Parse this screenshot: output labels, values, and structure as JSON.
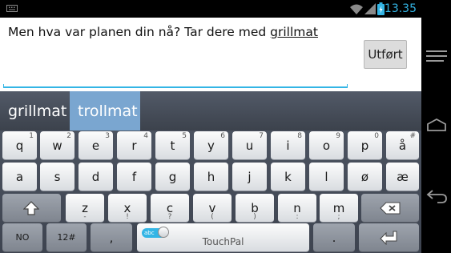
{
  "status_bar": {
    "time": "13.35"
  },
  "compose": {
    "text_before": "Men hva var planen din nå? Tar dere med ",
    "text_underlined": "grillmat",
    "done_label": "Utført"
  },
  "suggestions": [
    {
      "label": "grillmat",
      "selected": false
    },
    {
      "label": "trollmat",
      "selected": true
    }
  ],
  "keyboard": {
    "row1": [
      {
        "main": "q",
        "hint": "1"
      },
      {
        "main": "w",
        "hint": "2"
      },
      {
        "main": "e",
        "hint": "3"
      },
      {
        "main": "r",
        "hint": "4"
      },
      {
        "main": "t",
        "hint": "5"
      },
      {
        "main": "y",
        "hint": "6"
      },
      {
        "main": "u",
        "hint": "7"
      },
      {
        "main": "i",
        "hint": "8"
      },
      {
        "main": "o",
        "hint": "9"
      },
      {
        "main": "p",
        "hint": "0"
      },
      {
        "main": "å",
        "hint": "#"
      }
    ],
    "row2": [
      {
        "main": "a"
      },
      {
        "main": "s"
      },
      {
        "main": "d"
      },
      {
        "main": "f"
      },
      {
        "main": "g"
      },
      {
        "main": "h"
      },
      {
        "main": "j"
      },
      {
        "main": "k"
      },
      {
        "main": "l"
      },
      {
        "main": "ø"
      },
      {
        "main": "æ"
      }
    ],
    "row3": [
      {
        "main": "z",
        "sub": "-"
      },
      {
        "main": "x",
        "sub": "!"
      },
      {
        "main": "c",
        "sub": "?"
      },
      {
        "main": "v",
        "sub": "("
      },
      {
        "main": "b",
        "sub": ")"
      },
      {
        "main": "n",
        "sub": ":"
      },
      {
        "main": "m",
        "sub": ";"
      }
    ],
    "lang_label": "NO",
    "numbers_label": "12#",
    "comma_label": ",",
    "space_toggle_label": "abc",
    "space_brand": "TouchPal",
    "period_label": "."
  },
  "icons": {
    "shift": "shift-icon",
    "backspace": "backspace-icon",
    "enter": "enter-icon",
    "wifi": "wifi-icon",
    "signal": "signal-icon",
    "battery": "battery-icon",
    "keyboard_notify": "keyboard-notification-icon",
    "back": "back-icon",
    "home": "home-icon",
    "menu": "menu-icon"
  },
  "colors": {
    "accent": "#33b5e5",
    "suggestion_selected": "#7aa6d0"
  }
}
